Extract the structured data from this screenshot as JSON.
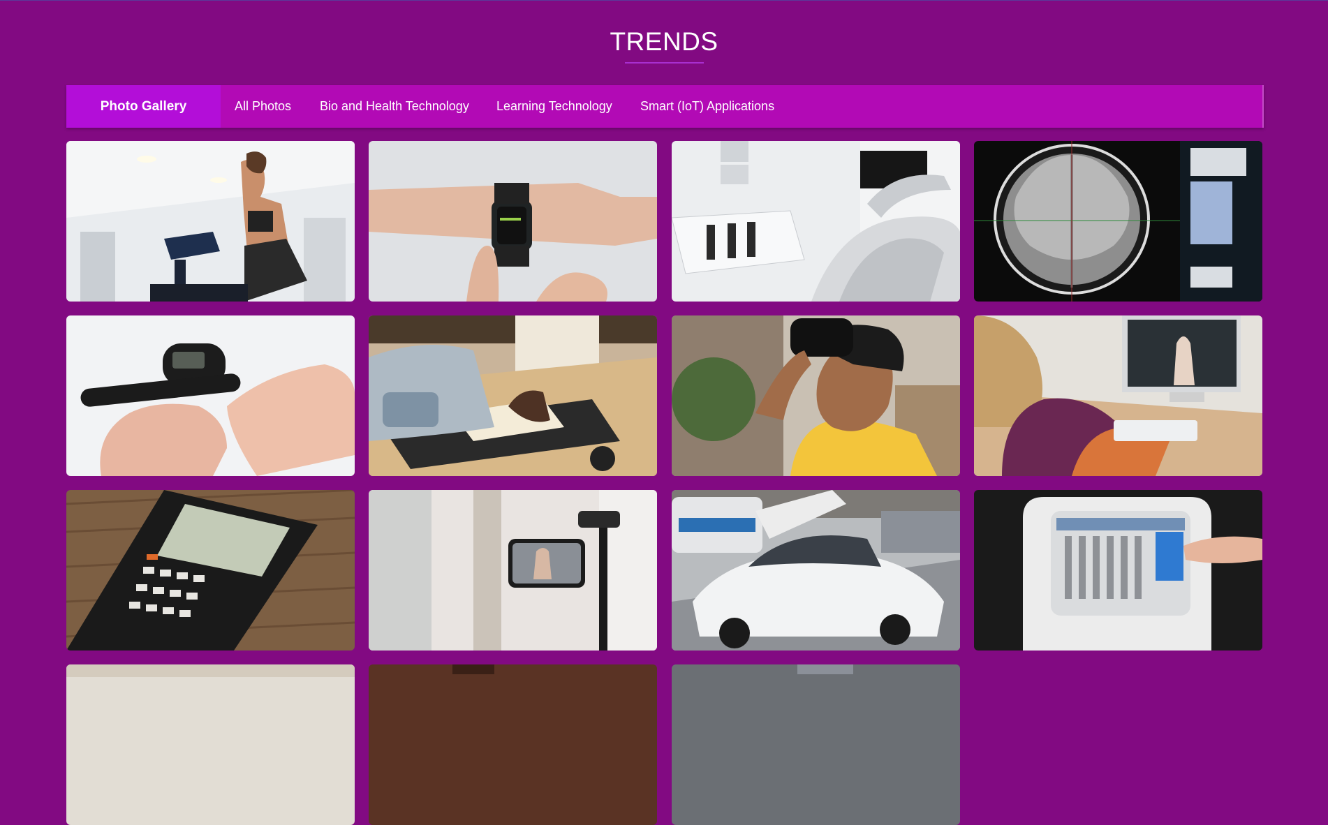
{
  "page": {
    "title": "TRENDS"
  },
  "nav": {
    "brand": "Photo Gallery",
    "items": [
      {
        "label": "All Photos"
      },
      {
        "label": "Bio and Health Technology"
      },
      {
        "label": "Learning Technology"
      },
      {
        "label": "Smart (IoT) Applications"
      }
    ]
  },
  "gallery": {
    "photos": [
      {
        "subject": "woman-on-treadmill"
      },
      {
        "subject": "smartwatch-on-wrist"
      },
      {
        "subject": "dental-chair"
      },
      {
        "subject": "brain-mri-scan"
      },
      {
        "subject": "glucose-meter"
      },
      {
        "subject": "book-scanner"
      },
      {
        "subject": "vr-headset-teen"
      },
      {
        "subject": "online-class-desktop"
      },
      {
        "subject": "casio-calculator"
      },
      {
        "subject": "phone-on-tripod"
      },
      {
        "subject": "white-concept-car"
      },
      {
        "subject": "smart-kiosk"
      },
      {
        "subject": "partial-photo"
      },
      {
        "subject": "partial-photo"
      },
      {
        "subject": "partial-photo"
      }
    ]
  }
}
